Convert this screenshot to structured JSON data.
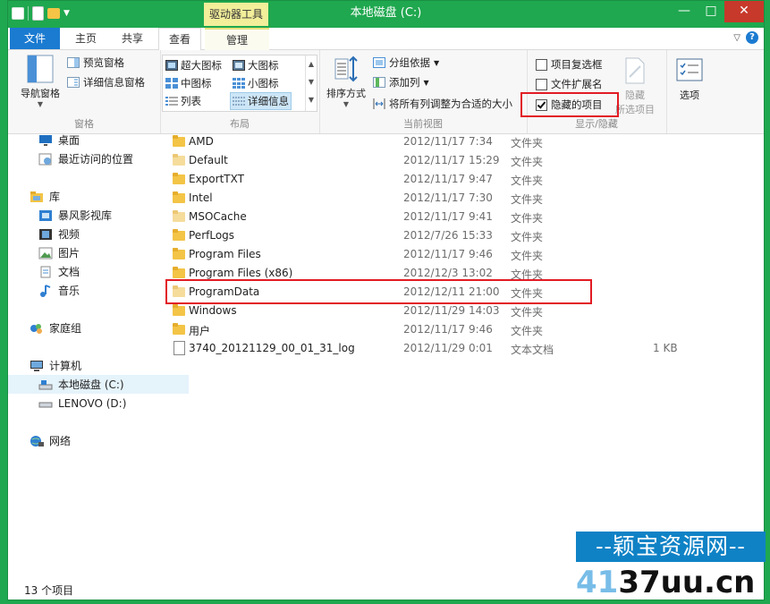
{
  "window": {
    "title": "本地磁盘 (C:)",
    "context_tab_group": "驱动器工具",
    "controls": {
      "minimize": "—",
      "maximize": "□",
      "close": "✕"
    }
  },
  "tabs": [
    {
      "label": "文件"
    },
    {
      "label": "主页"
    },
    {
      "label": "共享"
    },
    {
      "label": "查看"
    },
    {
      "label": "管理"
    }
  ],
  "ribbon": {
    "panes": {
      "label": "窗格",
      "nav_pane": "导航窗格",
      "preview_pane": "预览窗格",
      "details_pane": "详细信息窗格"
    },
    "layout": {
      "label": "布局",
      "items": [
        "超大图标",
        "大图标",
        "中图标",
        "小图标",
        "列表",
        "详细信息"
      ]
    },
    "current_view": {
      "label": "当前视图",
      "sort_by": "排序方式",
      "group_by": "分组依据",
      "add_column": "添加列",
      "fit_columns": "将所有列调整为合适的大小"
    },
    "show_hide": {
      "label": "显示/隐藏",
      "item_checkboxes": "项目复选框",
      "file_extensions": "文件扩展名",
      "hidden_items": "隐藏的项目",
      "hide_selected_line1": "隐藏",
      "hide_selected_line2": "所选项目"
    },
    "options": "选项"
  },
  "nav": {
    "items": [
      "桌面",
      "最近访问的位置",
      "库",
      "暴风影视库",
      "视频",
      "图片",
      "文档",
      "音乐",
      "家庭组",
      "计算机",
      "本地磁盘 (C:)",
      "LENOVO (D:)",
      "网络"
    ]
  },
  "files": [
    {
      "name": "AMD",
      "date": "2012/11/17 7:34",
      "type": "文件夹",
      "size": ""
    },
    {
      "name": "Default",
      "date": "2012/11/17 15:29",
      "type": "文件夹",
      "size": ""
    },
    {
      "name": "ExportTXT",
      "date": "2012/11/17 9:47",
      "type": "文件夹",
      "size": ""
    },
    {
      "name": "Intel",
      "date": "2012/11/17 7:30",
      "type": "文件夹",
      "size": ""
    },
    {
      "name": "MSOCache",
      "date": "2012/11/17 9:41",
      "type": "文件夹",
      "size": ""
    },
    {
      "name": "PerfLogs",
      "date": "2012/7/26 15:33",
      "type": "文件夹",
      "size": ""
    },
    {
      "name": "Program Files",
      "date": "2012/11/17 9:46",
      "type": "文件夹",
      "size": ""
    },
    {
      "name": "Program Files (x86)",
      "date": "2012/12/3 13:02",
      "type": "文件夹",
      "size": ""
    },
    {
      "name": "ProgramData",
      "date": "2012/12/11 21:00",
      "type": "文件夹",
      "size": ""
    },
    {
      "name": "Windows",
      "date": "2012/11/29 14:03",
      "type": "文件夹",
      "size": ""
    },
    {
      "name": "用户",
      "date": "2012/11/17 9:46",
      "type": "文件夹",
      "size": ""
    },
    {
      "name": "3740_20121129_00_01_31_log",
      "date": "2012/11/29 0:01",
      "type": "文本文档",
      "size": "1 KB"
    }
  ],
  "status": {
    "count": "13 个项目"
  },
  "watermark": {
    "line1": "--颖宝资源网--",
    "line2a": "41",
    "line2b": "37uu.cn"
  }
}
